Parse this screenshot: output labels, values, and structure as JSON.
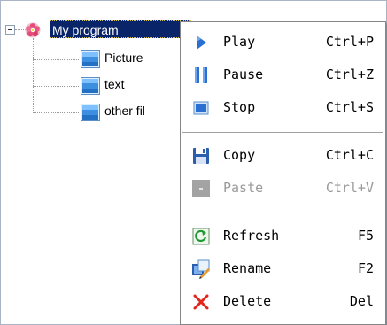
{
  "tree": {
    "root": {
      "label": "My program",
      "expander": "collapse-minus",
      "icon": "program-flower-icon",
      "expanded": true
    },
    "children": [
      {
        "label": "Picture",
        "icon": "page-window-icon"
      },
      {
        "label": "text",
        "icon": "page-window-icon"
      },
      {
        "label": "other fil",
        "icon": "page-window-icon"
      }
    ]
  },
  "context_menu": {
    "items": [
      {
        "label": "Play",
        "shortcut": "Ctrl+P",
        "icon": "play-icon",
        "enabled": true
      },
      {
        "label": "Pause",
        "shortcut": "Ctrl+Z",
        "icon": "pause-icon",
        "enabled": true
      },
      {
        "label": "Stop",
        "shortcut": "Ctrl+S",
        "icon": "stop-icon",
        "enabled": true
      },
      {
        "label": "Copy",
        "shortcut": "Ctrl+C",
        "icon": "floppy-disk-icon",
        "enabled": true
      },
      {
        "label": "Paste",
        "shortcut": "Ctrl+V",
        "icon": "paste-icon",
        "enabled": false
      },
      {
        "label": "Refresh",
        "shortcut": "F5",
        "icon": "refresh-icon",
        "enabled": true
      },
      {
        "label": "Rename",
        "shortcut": "F2",
        "icon": "rename-icon",
        "enabled": true
      },
      {
        "label": "Delete",
        "shortcut": "Del",
        "icon": "delete-x-icon",
        "enabled": true
      }
    ]
  },
  "colors": {
    "selection_bg": "#0a246a",
    "selection_text": "#ffffff",
    "disabled_text": "#9a9a9a",
    "menu_border": "#868686",
    "play_blue": "#2a6fd1",
    "delete_red": "#e1261c"
  }
}
